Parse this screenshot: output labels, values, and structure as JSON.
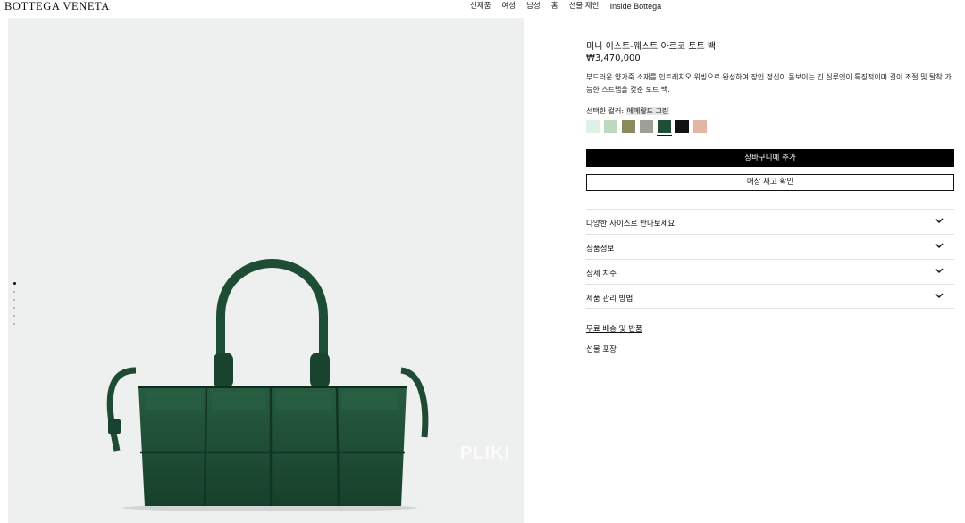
{
  "header": {
    "logo": "BOTTEGA VENETA",
    "nav": [
      "신제품",
      "여성",
      "남성",
      "홈",
      "선물 제안",
      "Inside Bottega"
    ]
  },
  "gallery": {
    "watermark": "PLIKI",
    "dot_count": 6,
    "active_dot": 0
  },
  "product": {
    "title": "미니 이스트-웨스트 아르코 토트 백",
    "price": "₩3,470,000",
    "description": "부드러운 양가죽 소재를 인트레치오 위빙으로 완성하여 장인 정신이 돋보이는 긴 실루엣이 특징적이며 길이 조절 및 탈착 가능한 스트랩을 갖춘 토트 백.",
    "color_label": "선택한 컬러:",
    "color_value": "에메랄드 그린",
    "swatches": [
      {
        "name": "swatch-mint",
        "color": "#dff0e6"
      },
      {
        "name": "swatch-pale-green",
        "color": "#bcd9bf"
      },
      {
        "name": "swatch-olive",
        "color": "#8a8b5c"
      },
      {
        "name": "swatch-sage-grey",
        "color": "#9da195"
      },
      {
        "name": "swatch-emerald-green",
        "color": "#1f4e37",
        "selected": true
      },
      {
        "name": "swatch-black",
        "color": "#121212"
      },
      {
        "name": "swatch-blush",
        "color": "#e3b5a4"
      }
    ],
    "add_to_cart": "장바구니에 추가",
    "check_store": "매장 재고 확인"
  },
  "accordions": [
    {
      "label": "다양한 사이즈로 만나보세요"
    },
    {
      "label": "상품정보"
    },
    {
      "label": "상세 치수"
    },
    {
      "label": "제품 관리 방법"
    }
  ],
  "links": {
    "shipping": "무료 배송 및 반품",
    "gift_wrap": "선물 포장"
  },
  "colors": {
    "bag": "#1e4d36",
    "gallery_bg": "#eef0ef",
    "button_primary": "#000000"
  }
}
